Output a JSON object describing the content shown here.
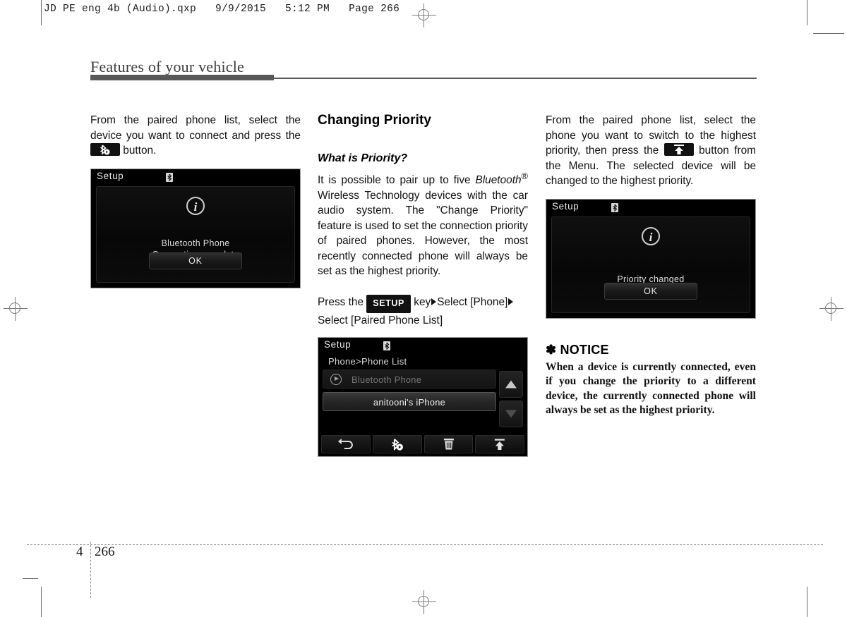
{
  "print_marks": {
    "file_banner": "JD PE eng 4b (Audio).qxp   9/9/2015   5:12 PM   Page 266"
  },
  "header": {
    "title": "Features of your vehicle"
  },
  "columns": {
    "left": {
      "intro_part1": "From the paired phone list, select the device you want to connect and press the",
      "intro_part2": "button.",
      "button_icon": "bluetooth-connect-icon",
      "screenshot": {
        "title": "Setup",
        "bluetooth_icon": "bluetooth-icon",
        "info_icon": "info-icon",
        "message_line1": "Bluetooth Phone",
        "message_line2": "Connection complete",
        "ok_label": "OK"
      }
    },
    "middle": {
      "section_title": "Changing Priority",
      "sub_title": "What is Priority?",
      "paragraph_a": "It is possible to pair up to five",
      "paragraph_bluetooth": "Bluetooth",
      "paragraph_reg": "®",
      "paragraph_b": "Wireless Technology devices with the car audio system. The \"Change Priority\" feature is used to set the connection priority of paired phones. However, the most recently connected phone will always be set as the highest priority.",
      "press_prefix": "Press   the",
      "setup_key_label": "SETUP",
      "press_mid": "key",
      "press_select1": "Select [Phone]",
      "press_select2": "Select [Paired Phone List]",
      "screenshot": {
        "title": "Setup",
        "bluetooth_icon": "bluetooth-icon",
        "breadcrumb": "Phone>Phone List",
        "items": [
          {
            "label": "Bluetooth Phone",
            "state": "connected-dim",
            "icon": "play-circle-icon"
          },
          {
            "label": "anitooni's iPhone",
            "state": "selected",
            "icon": ""
          }
        ],
        "scroll_up": "scroll-up-icon",
        "scroll_down": "scroll-down-icon",
        "toolbar": [
          {
            "icon": "back-arrow-icon"
          },
          {
            "icon": "bluetooth-connect-icon"
          },
          {
            "icon": "trash-icon"
          },
          {
            "icon": "move-to-top-icon"
          }
        ]
      }
    },
    "right": {
      "intro_part1": "From the paired phone list, select the phone you want to switch to the highest priority, then press the",
      "intro_part2": "button from the Menu. The selected device will be changed to the highest priority.",
      "button_icon": "move-to-top-icon",
      "screenshot": {
        "title": "Setup",
        "bluetooth_icon": "bluetooth-icon",
        "info_icon": "info-icon",
        "message_line1": "Priority changed",
        "ok_label": "OK"
      },
      "notice": {
        "asterisk": "✽",
        "heading": "NOTICE",
        "body": "When a device is currently connected, even if you change the priority to a different device, the currently connected phone will always be set as the highest priority."
      }
    }
  },
  "footer": {
    "chapter": "4",
    "page": "266"
  },
  "colors": {
    "header_rule": "#585858",
    "screen_background": "#000000",
    "body_text": "#111111"
  }
}
